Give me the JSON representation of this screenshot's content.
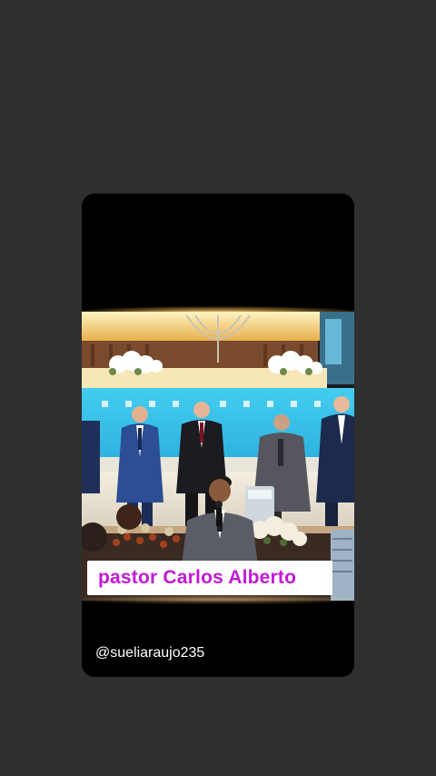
{
  "story": {
    "caption_text": "pastor Carlos Alberto",
    "username": "@sueliaraujo235"
  },
  "colors": {
    "background": "#2f2f2f",
    "card": "#000000",
    "caption_text": "#c318d8",
    "stage_blue": "#38c3ea"
  }
}
